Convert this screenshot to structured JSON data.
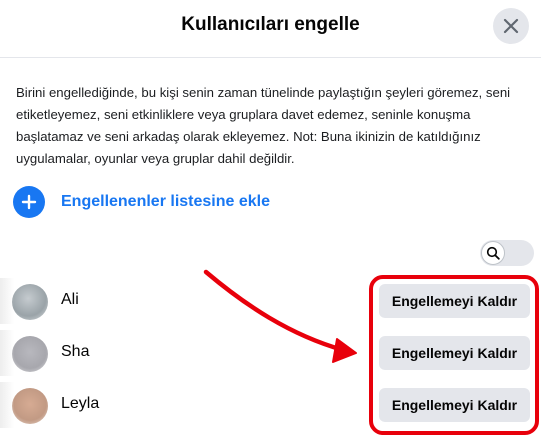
{
  "dialog": {
    "title": "Kullanıcıları engelle",
    "close_icon": "close-icon",
    "description": "Birini engellediğinde, bu kişi senin zaman tünelinde paylaştığın şeyleri göremez, seni etiketleyemez, seni etkinliklere veya gruplara davet edemez, seninle konuşma başlatamaz ve seni arkadaş olarak ekleyemez. Not: Buna ikinizin de katıldığınız uygulamalar, oyunlar veya gruplar dahil değildir.",
    "add_label": "Engellenenler listesine ekle",
    "add_icon": "plus-icon",
    "search_icon": "search-icon"
  },
  "blocked_users": [
    {
      "name": "Ali",
      "button_label": "Engellemeyi Kaldır",
      "avatar_color": "#9aa3a8"
    },
    {
      "name": "Sha",
      "button_label": "Engellemeyi Kaldır",
      "avatar_color": "#a7a7ad"
    },
    {
      "name": "Leyla",
      "button_label": "Engellemeyi Kaldır",
      "avatar_color": "#c29a84"
    }
  ],
  "colors": {
    "accent": "#1877f2",
    "button_bg": "#e4e6eb",
    "annotation": "#e8000b"
  }
}
